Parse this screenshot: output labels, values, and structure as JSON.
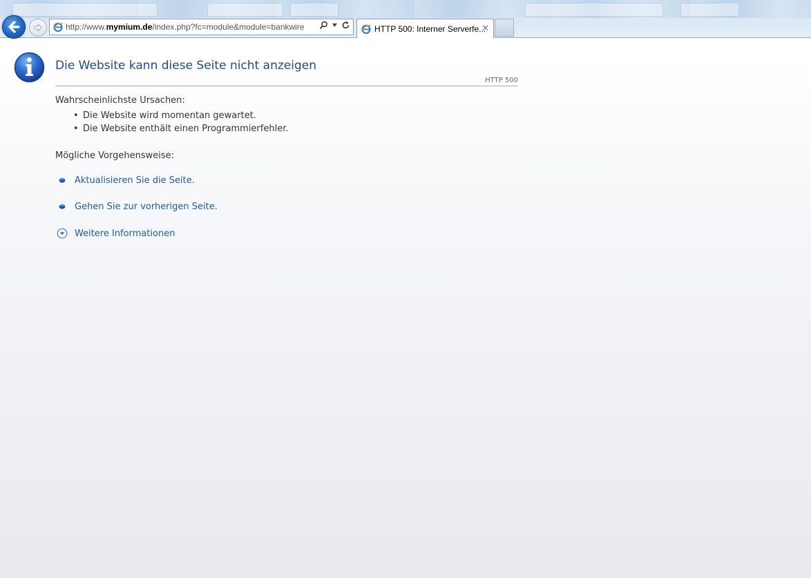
{
  "browser": {
    "address_url_prefix": "http://www.",
    "address_url_domain": "mymium.de",
    "address_url_rest": "/index.php?fc=module&module=bankwire",
    "tab_title": "HTTP 500: Interner Serverfe...",
    "tab_close": "✕"
  },
  "content": {
    "title": "Die Website kann diese Seite nicht anzeigen",
    "http_code": "HTTP 500",
    "causes_label": "Wahrscheinlichste Ursachen:",
    "causes": [
      "Die Website wird momentan gewartet.",
      "Die Website enthält einen Programmierfehler."
    ],
    "actions_label": "Mögliche Vorgehensweise:",
    "actions": [
      "Aktualisieren Sie die Seite.",
      "Gehen Sie zur vorherigen Seite."
    ],
    "more_info": "Weitere Informationen"
  },
  "colors": {
    "title": "#1f4a8a",
    "link": "#1f5c9a",
    "text": "#333333"
  }
}
